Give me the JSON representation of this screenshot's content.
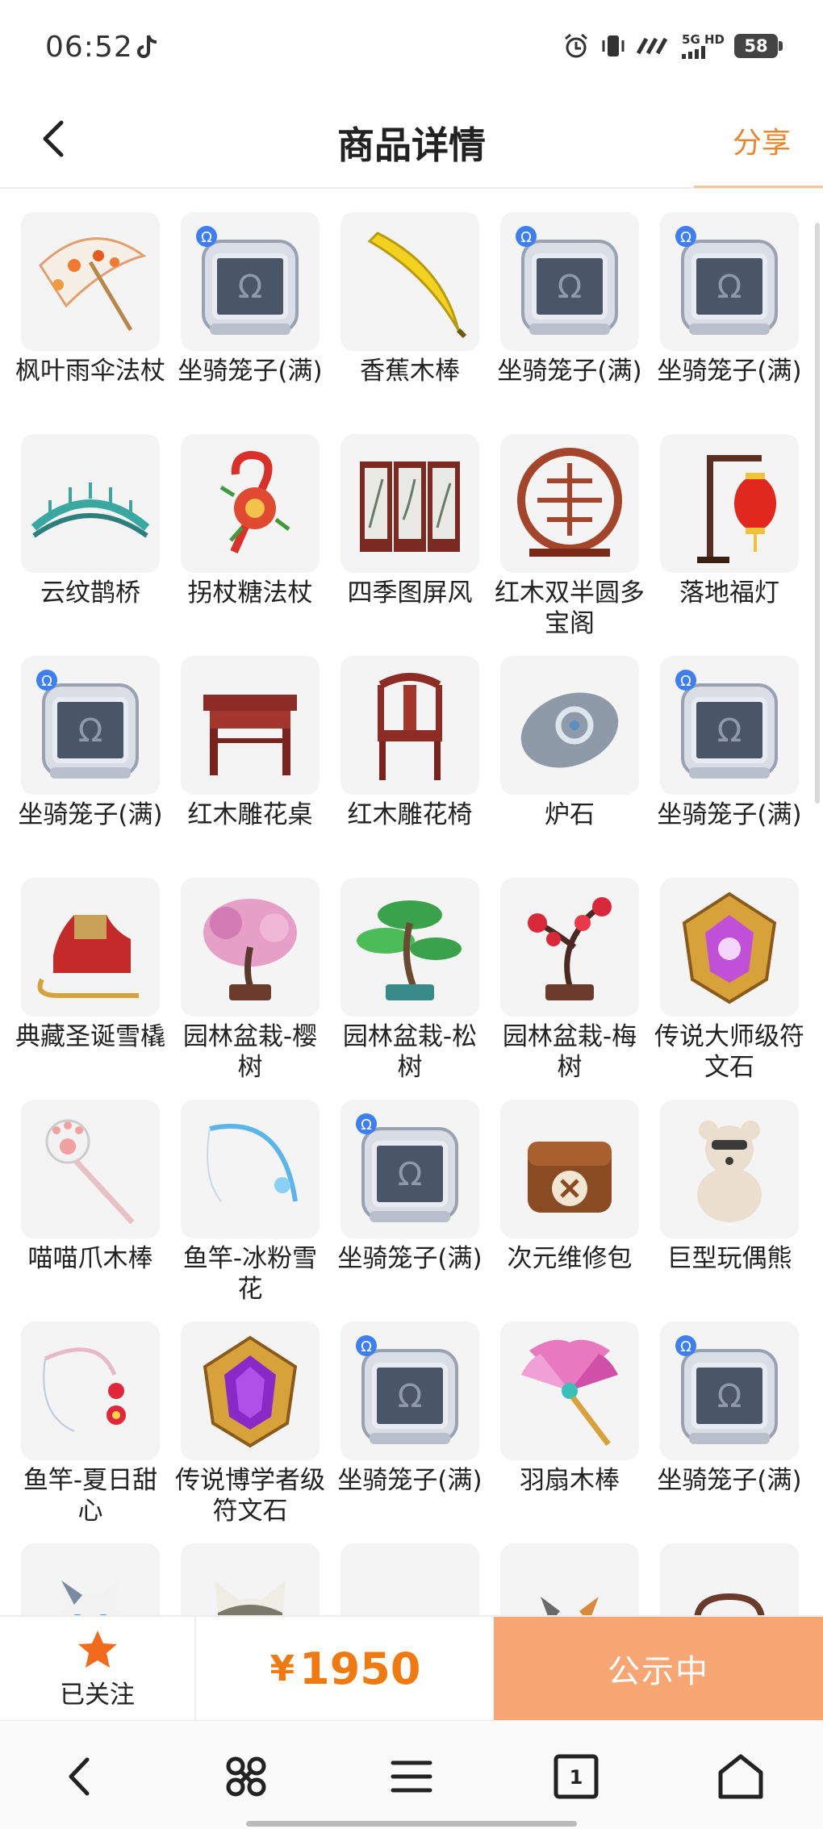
{
  "status_bar": {
    "time": "06:52",
    "network": "5G HD",
    "battery": "58",
    "icons": [
      "tiktok-icon",
      "alarm-icon",
      "vibrate-icon",
      "speed-icon",
      "signal-icon"
    ]
  },
  "header": {
    "title": "商品详情",
    "share_label": "分享",
    "back_icon": "chevron-left-icon"
  },
  "items": [
    {
      "name": "枫叶雨伞法杖",
      "icon": "umbrella-staff"
    },
    {
      "name": "坐骑笼子(满)",
      "icon": "mount-cage"
    },
    {
      "name": "香蕉木棒",
      "icon": "banana-stick"
    },
    {
      "name": "坐骑笼子(满)",
      "icon": "mount-cage"
    },
    {
      "name": "坐骑笼子(满)",
      "icon": "mount-cage"
    },
    {
      "name": "云纹鹊桥",
      "icon": "arched-bridge"
    },
    {
      "name": "拐杖糖法杖",
      "icon": "candy-cane-staff"
    },
    {
      "name": "四季图屏风",
      "icon": "folding-screen"
    },
    {
      "name": "红木双半圆多宝阁",
      "icon": "round-shelf"
    },
    {
      "name": "落地福灯",
      "icon": "lantern"
    },
    {
      "name": "坐骑笼子(满)",
      "icon": "mount-cage"
    },
    {
      "name": "红木雕花桌",
      "icon": "carved-table"
    },
    {
      "name": "红木雕花椅",
      "icon": "carved-chair"
    },
    {
      "name": "炉石",
      "icon": "hearthstone"
    },
    {
      "name": "坐骑笼子(满)",
      "icon": "mount-cage"
    },
    {
      "name": "典藏圣诞雪橇",
      "icon": "sleigh"
    },
    {
      "name": "园林盆栽-樱树",
      "icon": "bonsai-cherry"
    },
    {
      "name": "园林盆栽-松树",
      "icon": "bonsai-pine"
    },
    {
      "name": "园林盆栽-梅树",
      "icon": "bonsai-plum"
    },
    {
      "name": "传说大师级符文石",
      "icon": "rune-gold"
    },
    {
      "name": "喵喵爪木棒",
      "icon": "paw-stick"
    },
    {
      "name": "鱼竿-冰粉雪花",
      "icon": "fishing-rod-ice"
    },
    {
      "name": "坐骑笼子(满)",
      "icon": "mount-cage"
    },
    {
      "name": "次元维修包",
      "icon": "repair-bag"
    },
    {
      "name": "巨型玩偶熊",
      "icon": "teddy-bear"
    },
    {
      "name": "鱼竿-夏日甜心",
      "icon": "fishing-rod-summer"
    },
    {
      "name": "传说博学者级符文石",
      "icon": "rune-purple"
    },
    {
      "name": "坐骑笼子(满)",
      "icon": "mount-cage"
    },
    {
      "name": "羽扇木棒",
      "icon": "feather-fan-stick"
    },
    {
      "name": "坐骑笼子(满)",
      "icon": "mount-cage"
    },
    {
      "name": "",
      "icon": "cat-blue"
    },
    {
      "name": "",
      "icon": "cat-grey"
    },
    {
      "name": "",
      "icon": "cage-partial"
    },
    {
      "name": "",
      "icon": "cat-calico"
    },
    {
      "name": "",
      "icon": "star-chair"
    }
  ],
  "action_bar": {
    "follow_label": "已关注",
    "price_symbol": "¥",
    "price": "1950",
    "status_label": "公示中"
  },
  "browser_nav": {
    "tab_count": "1",
    "icons": [
      "back-icon",
      "apps-icon",
      "menu-icon",
      "tabs-icon",
      "home-icon"
    ]
  },
  "colors": {
    "accent": "#f07a10",
    "status_button": "#f9a675",
    "share": "#e8862e",
    "star": "#f26a1b"
  }
}
